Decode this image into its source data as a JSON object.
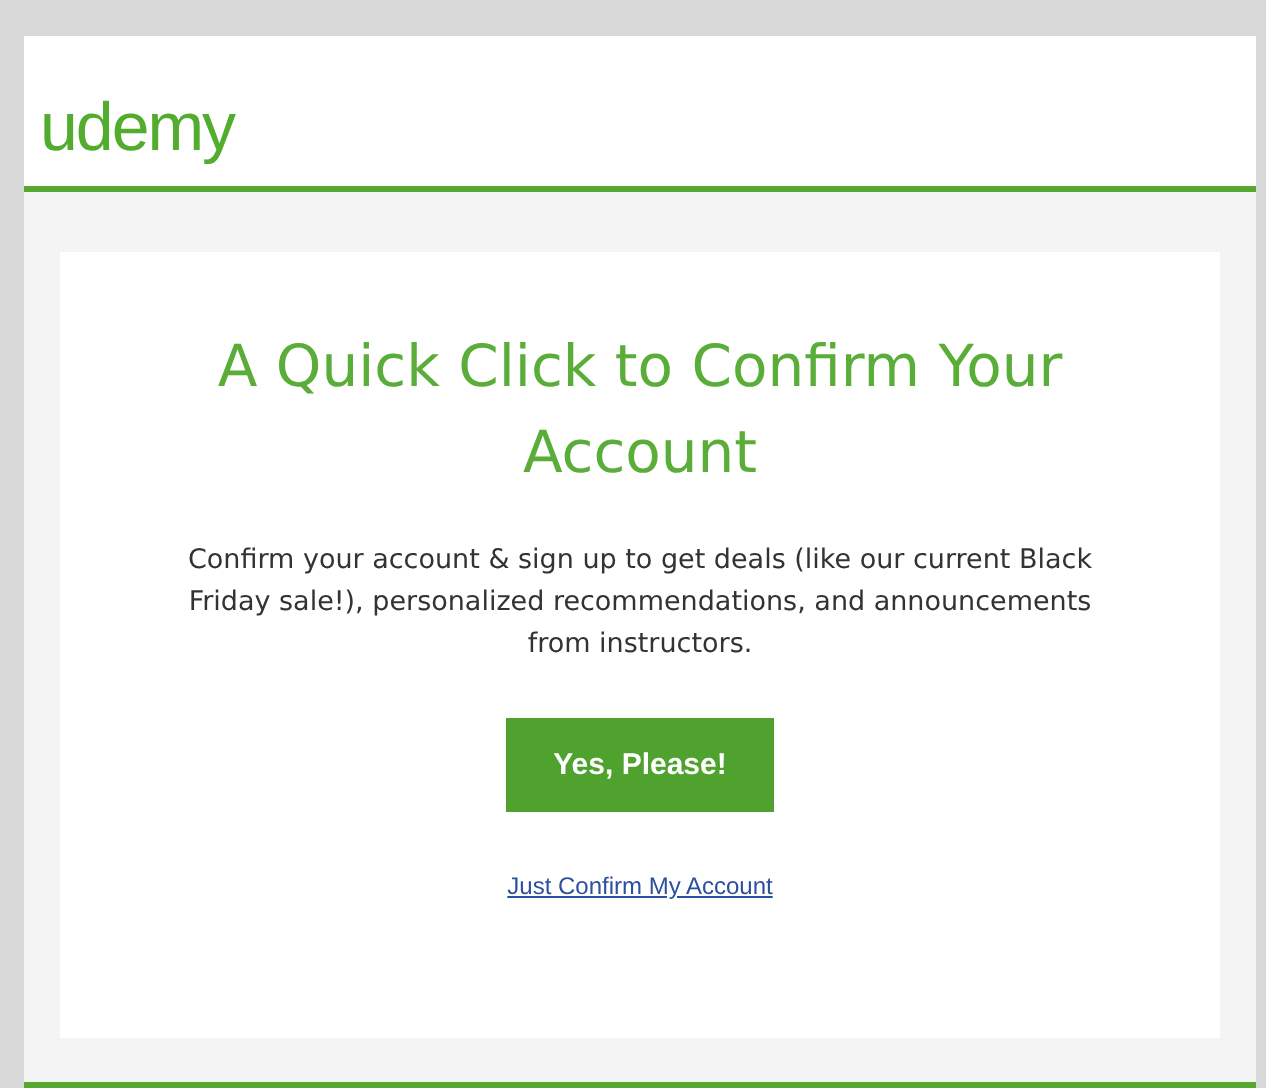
{
  "header": {
    "logo": "udemy"
  },
  "message": {
    "title": "A Quick Click to Confirm Your Account",
    "body": "Confirm your account & sign up to get deals (like our current Black Friday sale!), personalized recommendations, and announcements from instructors.",
    "primary_button": "Yes, Please!",
    "link": "Just Confirm My Account"
  }
}
